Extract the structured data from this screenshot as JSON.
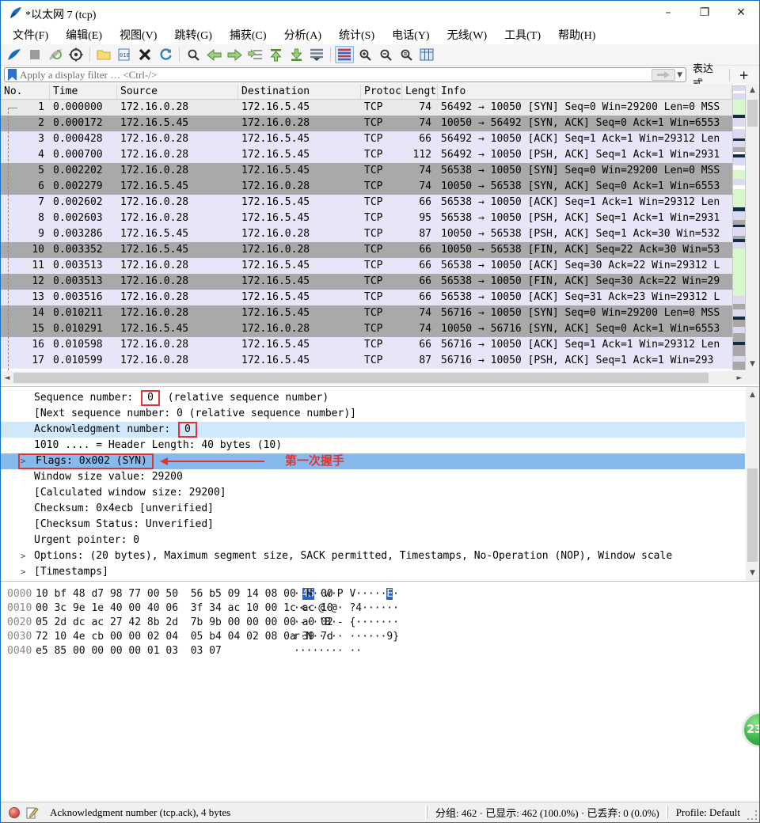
{
  "window": {
    "title": "*以太网 7 (tcp)",
    "minimize": "–",
    "maximize": "❐",
    "close": "✕"
  },
  "menu": {
    "items": [
      "文件(F)",
      "编辑(E)",
      "视图(V)",
      "跳转(G)",
      "捕获(C)",
      "分析(A)",
      "统计(S)",
      "电话(Y)",
      "无线(W)",
      "工具(T)",
      "帮助(H)"
    ]
  },
  "toolbar": {
    "icons": [
      "start-capture",
      "stop-capture",
      "restart-capture",
      "capture-options",
      "sep",
      "open-file",
      "save-file",
      "close-file",
      "reload",
      "sep",
      "find-packet",
      "go-back",
      "go-forward",
      "go-to-packet",
      "go-top",
      "go-bottom",
      "auto-scroll",
      "sep",
      "colorize",
      "zoom-in",
      "zoom-out",
      "zoom-normal",
      "resize-columns"
    ]
  },
  "filter": {
    "placeholder": "Apply a display filter … <Ctrl-/>",
    "expression_label": "表达式…",
    "add_label": "+"
  },
  "packet_list": {
    "columns": [
      "No.",
      "Time",
      "Source",
      "Destination",
      "Protocol",
      "Length",
      "Info"
    ],
    "rows": [
      {
        "no": "1",
        "time": "0.000000",
        "src": "172.16.0.28",
        "dst": "172.16.5.45",
        "proto": "TCP",
        "len": "74",
        "info": "56492 → 10050 [SYN] Seq=0 Win=29200 Len=0 MSS",
        "color": "sel"
      },
      {
        "no": "2",
        "time": "0.000172",
        "src": "172.16.5.45",
        "dst": "172.16.0.28",
        "proto": "TCP",
        "len": "74",
        "info": "10050 → 56492 [SYN, ACK] Seq=0 Ack=1 Win=6553",
        "color": "gray"
      },
      {
        "no": "3",
        "time": "0.000428",
        "src": "172.16.0.28",
        "dst": "172.16.5.45",
        "proto": "TCP",
        "len": "66",
        "info": "56492 → 10050 [ACK] Seq=1 Ack=1 Win=29312 Len",
        "color": "lav"
      },
      {
        "no": "4",
        "time": "0.000700",
        "src": "172.16.0.28",
        "dst": "172.16.5.45",
        "proto": "TCP",
        "len": "112",
        "info": "56492 → 10050 [PSH, ACK] Seq=1 Ack=1 Win=2931",
        "color": "lav"
      },
      {
        "no": "5",
        "time": "0.002202",
        "src": "172.16.0.28",
        "dst": "172.16.5.45",
        "proto": "TCP",
        "len": "74",
        "info": "56538 → 10050 [SYN] Seq=0 Win=29200 Len=0 MSS",
        "color": "gray"
      },
      {
        "no": "6",
        "time": "0.002279",
        "src": "172.16.5.45",
        "dst": "172.16.0.28",
        "proto": "TCP",
        "len": "74",
        "info": "10050 → 56538 [SYN, ACK] Seq=0 Ack=1 Win=6553",
        "color": "gray"
      },
      {
        "no": "7",
        "time": "0.002602",
        "src": "172.16.0.28",
        "dst": "172.16.5.45",
        "proto": "TCP",
        "len": "66",
        "info": "56538 → 10050 [ACK] Seq=1 Ack=1 Win=29312 Len",
        "color": "lav"
      },
      {
        "no": "8",
        "time": "0.002603",
        "src": "172.16.0.28",
        "dst": "172.16.5.45",
        "proto": "TCP",
        "len": "95",
        "info": "56538 → 10050 [PSH, ACK] Seq=1 Ack=1 Win=2931",
        "color": "lav"
      },
      {
        "no": "9",
        "time": "0.003286",
        "src": "172.16.5.45",
        "dst": "172.16.0.28",
        "proto": "TCP",
        "len": "87",
        "info": "10050 → 56538 [PSH, ACK] Seq=1 Ack=30 Win=532",
        "color": "lav"
      },
      {
        "no": "10",
        "time": "0.003352",
        "src": "172.16.5.45",
        "dst": "172.16.0.28",
        "proto": "TCP",
        "len": "66",
        "info": "10050 → 56538 [FIN, ACK] Seq=22 Ack=30 Win=53",
        "color": "gray"
      },
      {
        "no": "11",
        "time": "0.003513",
        "src": "172.16.0.28",
        "dst": "172.16.5.45",
        "proto": "TCP",
        "len": "66",
        "info": "56538 → 10050 [ACK] Seq=30 Ack=22 Win=29312 L",
        "color": "lav"
      },
      {
        "no": "12",
        "time": "0.003513",
        "src": "172.16.0.28",
        "dst": "172.16.5.45",
        "proto": "TCP",
        "len": "66",
        "info": "56538 → 10050 [FIN, ACK] Seq=30 Ack=22 Win=29",
        "color": "gray"
      },
      {
        "no": "13",
        "time": "0.003516",
        "src": "172.16.0.28",
        "dst": "172.16.5.45",
        "proto": "TCP",
        "len": "66",
        "info": "56538 → 10050 [ACK] Seq=31 Ack=23 Win=29312 L",
        "color": "lav"
      },
      {
        "no": "14",
        "time": "0.010211",
        "src": "172.16.0.28",
        "dst": "172.16.5.45",
        "proto": "TCP",
        "len": "74",
        "info": "56716 → 10050 [SYN] Seq=0 Win=29200 Len=0 MSS",
        "color": "gray"
      },
      {
        "no": "15",
        "time": "0.010291",
        "src": "172.16.5.45",
        "dst": "172.16.0.28",
        "proto": "TCP",
        "len": "74",
        "info": "10050 → 56716 [SYN, ACK] Seq=0 Ack=1 Win=6553",
        "color": "gray"
      },
      {
        "no": "16",
        "time": "0.010598",
        "src": "172.16.0.28",
        "dst": "172.16.5.45",
        "proto": "TCP",
        "len": "66",
        "info": "56716 → 10050 [ACK] Seq=1 Ack=1 Win=29312 Len",
        "color": "lav"
      },
      {
        "no": "17",
        "time": "0.010599",
        "src": "172.16.0.28",
        "dst": "172.16.5.45",
        "proto": "TCP",
        "len": "87",
        "info": "56716 → 10050 [PSH, ACK] Seq=1 Ack=1 Win=293",
        "color": "lav"
      }
    ]
  },
  "details": {
    "lines": [
      {
        "pre": "Sequence number: ",
        "boxed": "0",
        "post": "   (relative sequence number)",
        "highlight": "none",
        "expander": false
      },
      {
        "pre": "[Next sequence number: 0    (relative sequence number)]",
        "boxed": "",
        "post": "",
        "highlight": "none",
        "expander": false
      },
      {
        "pre": "Acknowledgment number: ",
        "boxed": "0",
        "post": "",
        "highlight": "light",
        "expander": false
      },
      {
        "pre": "1010 .... = Header Length: 40 bytes (10)",
        "boxed": "",
        "post": "",
        "highlight": "none",
        "expander": false
      },
      {
        "pre": "",
        "boxed": "Flags: 0x002 (SYN)",
        "post": "",
        "highlight": "strong",
        "expander": true,
        "annotated": true
      },
      {
        "pre": "Window size value: 29200",
        "boxed": "",
        "post": "",
        "highlight": "none",
        "expander": false
      },
      {
        "pre": "[Calculated window size: 29200]",
        "boxed": "",
        "post": "",
        "highlight": "none",
        "expander": false
      },
      {
        "pre": "Checksum: 0x4ecb [unverified]",
        "boxed": "",
        "post": "",
        "highlight": "none",
        "expander": false
      },
      {
        "pre": "[Checksum Status: Unverified]",
        "boxed": "",
        "post": "",
        "highlight": "none",
        "expander": false
      },
      {
        "pre": "Urgent pointer: 0",
        "boxed": "",
        "post": "",
        "highlight": "none",
        "expander": false
      },
      {
        "pre": "Options: (20 bytes), Maximum segment size, SACK permitted, Timestamps, No-Operation (NOP), Window scale",
        "boxed": "",
        "post": "",
        "highlight": "none",
        "expander": true
      },
      {
        "pre": "[Timestamps]",
        "boxed": "",
        "post": "",
        "highlight": "none",
        "expander": true
      }
    ],
    "annotation_label": "第一次握手"
  },
  "hex": {
    "rows": [
      {
        "offset": "0000",
        "bytes": [
          "10",
          "bf",
          "48",
          "d7",
          "98",
          "77",
          "00",
          "50",
          "56",
          "b5",
          "09",
          "14",
          "08",
          "00",
          "45",
          "00"
        ],
        "ascii": [
          "··H··w·P",
          "V·····E·"
        ],
        "hl_byte": 14,
        "hl_ascii_group": 1,
        "hl_ascii_idx": 6
      },
      {
        "offset": "0010",
        "bytes": [
          "00",
          "3c",
          "9e",
          "1e",
          "40",
          "00",
          "40",
          "06",
          "3f",
          "34",
          "ac",
          "10",
          "00",
          "1c",
          "ac",
          "10"
        ],
        "ascii": [
          "·<··@·@·",
          "?4······"
        ],
        "hl_byte": -1
      },
      {
        "offset": "0020",
        "bytes": [
          "05",
          "2d",
          "dc",
          "ac",
          "27",
          "42",
          "8b",
          "2d",
          "7b",
          "9b",
          "00",
          "00",
          "00",
          "00",
          "a0",
          "02"
        ],
        "ascii": [
          "·-··'B·-",
          "{·······"
        ],
        "hl_byte": -1
      },
      {
        "offset": "0030",
        "bytes": [
          "72",
          "10",
          "4e",
          "cb",
          "00",
          "00",
          "02",
          "04",
          "05",
          "b4",
          "04",
          "02",
          "08",
          "0a",
          "39",
          "7d"
        ],
        "ascii": [
          "r·N·····",
          "······9}"
        ],
        "hl_byte": -1
      },
      {
        "offset": "0040",
        "bytes": [
          "e5",
          "85",
          "00",
          "00",
          "00",
          "00",
          "01",
          "03",
          "03",
          "07"
        ],
        "ascii": [
          "········",
          "··"
        ],
        "hl_byte": -1
      }
    ]
  },
  "status": {
    "field_info": "Acknowledgment number (tcp.ack), 4 bytes",
    "counts": "分组: 462  ·  已显示: 462 (100.0%)  ·  已丢弃: 0 (0.0%)",
    "profile": "Profile: Default"
  },
  "badge": {
    "text": "23"
  },
  "minimap": {
    "stripes": [
      [
        "lav",
        5
      ],
      [
        "white",
        3
      ],
      [
        "lav",
        7
      ],
      [
        "green",
        16
      ],
      [
        "black",
        4
      ],
      [
        "lav",
        9
      ],
      [
        "white",
        3
      ],
      [
        "lav",
        10
      ],
      [
        "black",
        3
      ],
      [
        "lav",
        7
      ],
      [
        "gray",
        5
      ],
      [
        "white",
        3
      ],
      [
        "black",
        3
      ],
      [
        "lav",
        9
      ],
      [
        "white",
        5
      ],
      [
        "green",
        10
      ],
      [
        "lav",
        7
      ],
      [
        "white",
        4
      ],
      [
        "green",
        20
      ],
      [
        "black",
        4
      ],
      [
        "lav",
        10
      ],
      [
        "gray",
        5
      ],
      [
        "black",
        3
      ],
      [
        "lav",
        9
      ],
      [
        "gray",
        4
      ],
      [
        "black",
        3
      ],
      [
        "lav",
        7
      ],
      [
        "green",
        52
      ],
      [
        "lav",
        9
      ],
      [
        "gray",
        6
      ],
      [
        "lav",
        8
      ],
      [
        "black",
        3
      ],
      [
        "gray",
        8
      ],
      [
        "lav",
        7
      ],
      [
        "gray",
        10
      ],
      [
        "black",
        3
      ],
      [
        "gray",
        12
      ],
      [
        "lav",
        6
      ],
      [
        "gray",
        9
      ]
    ]
  },
  "colors": {
    "accent_blue": "#1273c8",
    "row_gray": "#a9a9a9",
    "row_lavender": "#e7e6f8",
    "highlight_light": "#cfe8fb",
    "highlight_strong": "#86baec",
    "annotation_red": "#e03434",
    "hex_selection": "#2a63c5",
    "minimap_green": "#d9f7cd",
    "minimap_black": "#152c42"
  }
}
